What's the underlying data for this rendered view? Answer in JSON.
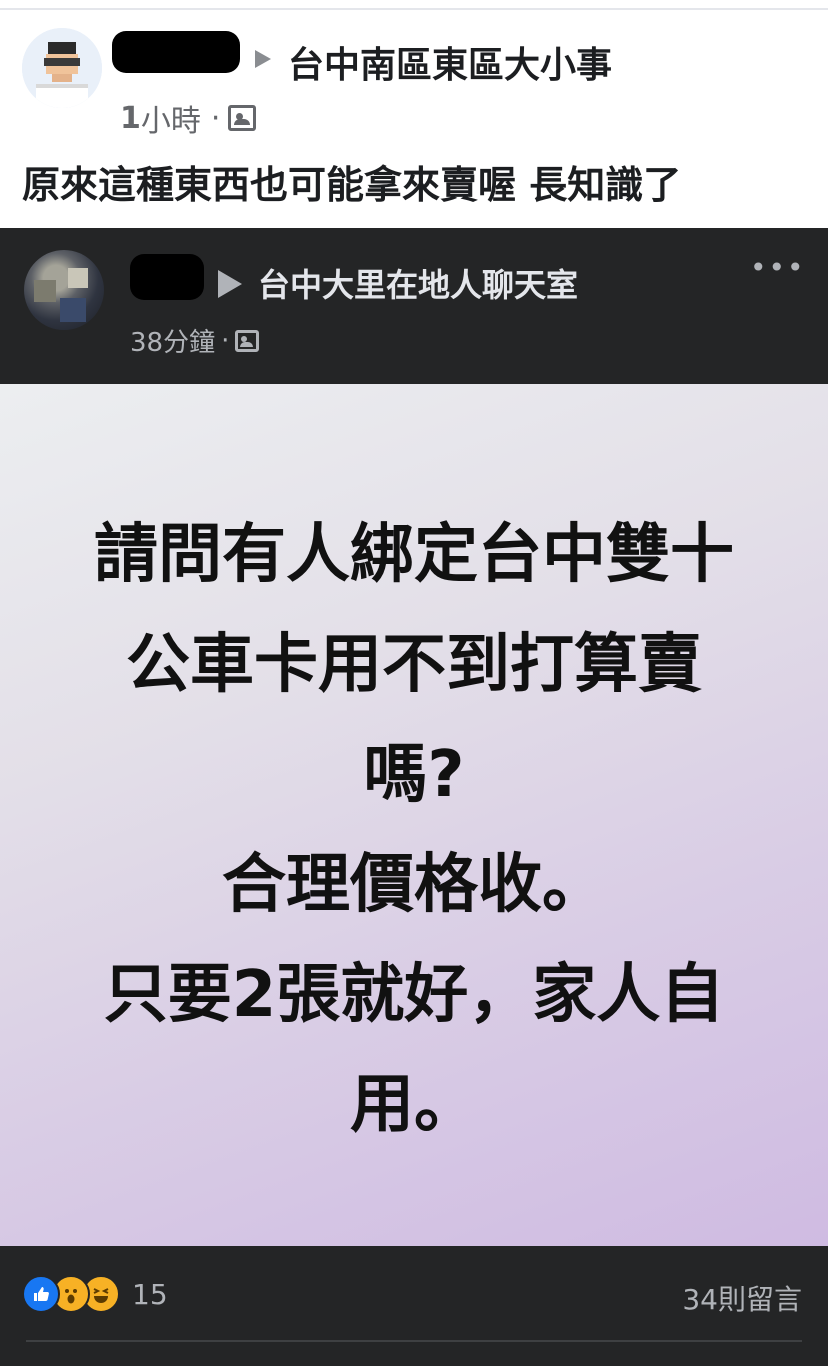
{
  "outer_post": {
    "group_name": "台中南區東區大小事",
    "time_number": "1",
    "time_unit": "小時",
    "separator": "·",
    "caption": "原來這種東西也可能拿來賣喔 長知識了"
  },
  "inner_post": {
    "group_name": "台中大里在地人聊天室",
    "time": "38分鐘",
    "separator": "·",
    "more_label": "•••",
    "image_text_lines": [
      "請問有人綁定台中雙十",
      "公車卡用不到打算賣",
      "嗎?",
      "合理價格收。",
      "只要2張就好，家人自",
      "用。"
    ]
  },
  "footer": {
    "reaction_count": "15",
    "comment_count": "34則留言",
    "reaction_icons": [
      "like-icon",
      "wow-icon",
      "haha-icon"
    ]
  },
  "colors": {
    "dark_bg": "#242526",
    "facebook_blue": "#1877f2",
    "reaction_yellow": "#f7b125"
  }
}
